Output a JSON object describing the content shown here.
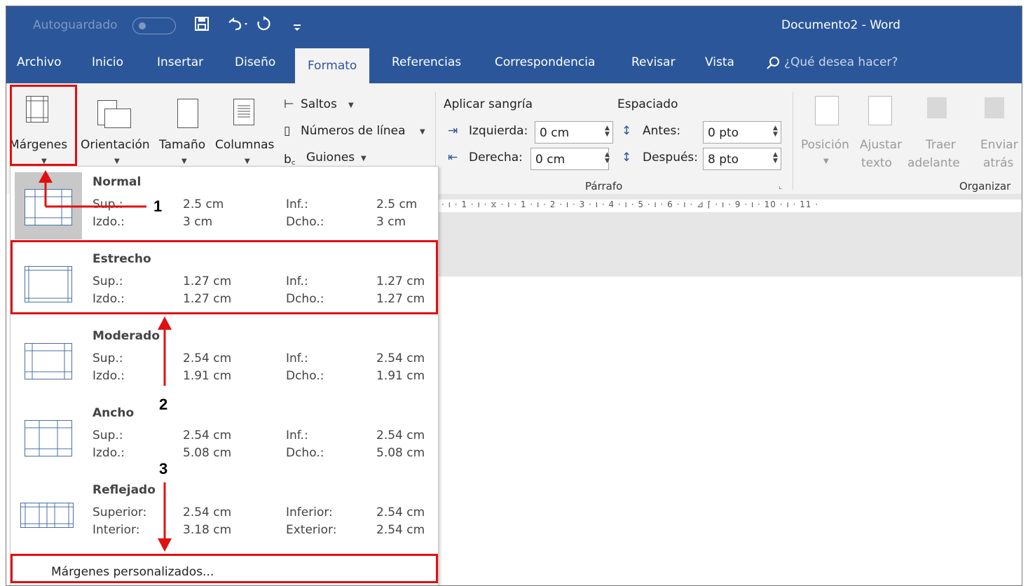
{
  "titlebar": {
    "autosave_label": "Autoguardado",
    "doc_title": "Documento2  -  Word",
    "save_icon": "save-icon",
    "undo_icon": "undo-icon",
    "redo_icon": "redo-icon",
    "customize_icon": "customize-qat-icon"
  },
  "tabs": [
    "Archivo",
    "Inicio",
    "Insertar",
    "Diseño",
    "Formato",
    "Referencias",
    "Correspondencia",
    "Revisar",
    "Vista"
  ],
  "active_tab": "Formato",
  "tellme": "¿Qué desea hacer?",
  "ribbon": {
    "margenes": "Márgenes",
    "orientacion": "Orientación",
    "tamano": "Tamaño",
    "columnas": "Columnas",
    "saltos": "Saltos",
    "numeros_linea": "Números de línea",
    "guiones": "Guiones",
    "aplicar_sangria": "Aplicar sangría",
    "izquierda_label": "Izquierda:",
    "izquierda_value": "0 cm",
    "derecha_label": "Derecha:",
    "derecha_value": "0 cm",
    "espaciado": "Espaciado",
    "antes_label": "Antes:",
    "antes_value": "0 pto",
    "despues_label": "Después:",
    "despues_value": "8 pto",
    "parrafo": "Párrafo",
    "posicion": "Posición",
    "ajustar_1": "Ajustar",
    "ajustar_2": "texto",
    "traer_1": "Traer",
    "traer_2": "adelante",
    "enviar_1": "Enviar",
    "enviar_2": "atrás",
    "organizar": "Organizar"
  },
  "ruler_text": "· ı · 1 · ı · ⧖ · ı · 1 · ı · 2 · ı · 3 · ı · 4 · ı · 5 · ı · 6 · ı · ⊿            ⌈ · ı · 9 · ı · 10 · ı · 11 ·",
  "margins": [
    {
      "name": "Normal",
      "l1": "Sup.:",
      "v1": "2.5 cm",
      "l2": "Inf.:",
      "v2": "2.5 cm",
      "l3": "Izdo.:",
      "v3": "3 cm",
      "l4": "Dcho.:",
      "v4": "3 cm"
    },
    {
      "name": "Estrecho",
      "l1": "Sup.:",
      "v1": "1.27 cm",
      "l2": "Inf.:",
      "v2": "1.27 cm",
      "l3": "Izdo.:",
      "v3": "1.27 cm",
      "l4": "Dcho.:",
      "v4": "1.27 cm"
    },
    {
      "name": "Moderado",
      "l1": "Sup.:",
      "v1": "2.54 cm",
      "l2": "Inf.:",
      "v2": "2.54 cm",
      "l3": "Izdo.:",
      "v3": "1.91 cm",
      "l4": "Dcho.:",
      "v4": "1.91 cm"
    },
    {
      "name": "Ancho",
      "l1": "Sup.:",
      "v1": "2.54 cm",
      "l2": "Inf.:",
      "v2": "2.54 cm",
      "l3": "Izdo.:",
      "v3": "5.08 cm",
      "l4": "Dcho.:",
      "v4": "5.08 cm"
    },
    {
      "name": "Reflejado",
      "l1": "Superior:",
      "v1": "2.54 cm",
      "l2": "Inferior:",
      "v2": "2.54 cm",
      "l3": "Interior:",
      "v3": "3.18 cm",
      "l4": "Exterior:",
      "v4": "2.54 cm"
    }
  ],
  "custom_margins": "Márgenes personalizados...",
  "callouts": [
    "1",
    "2",
    "3"
  ],
  "annotation_color": "#e01010",
  "word_blue": "#2b579a"
}
